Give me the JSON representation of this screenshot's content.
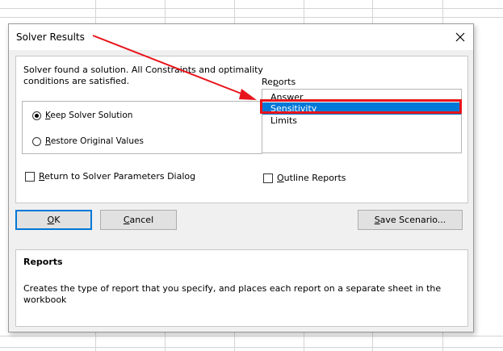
{
  "dialog": {
    "title": "Solver Results",
    "message": "Solver found a solution.  All Constraints and optimality conditions are satisfied.",
    "options": {
      "keep_label": "eep Solver Solution",
      "keep_mnemonic": "K",
      "keep_checked": true,
      "restore_label": "estore Original Values",
      "restore_mnemonic": "R",
      "restore_checked": false
    },
    "return_dialog": {
      "mnemonic": "R",
      "label": "eturn to Solver Parameters Dialog",
      "checked": false
    },
    "reports": {
      "label_pre": "Re",
      "label_mnemonic": "p",
      "label_post": "orts",
      "items": [
        "Answer",
        "Sensitivity",
        "Limits"
      ],
      "selected_index": 1
    },
    "outline_reports": {
      "mnemonic": "O",
      "label": "utline Reports",
      "checked": false
    },
    "buttons": {
      "ok_mnemonic": "O",
      "ok_rest": "K",
      "cancel_mnemonic": "C",
      "cancel_rest": "ancel",
      "save_mnemonic": "S",
      "save_rest": "ave Scenario..."
    },
    "description": {
      "title": "Reports",
      "text": "Creates the type of report that you specify, and places each report on a separate sheet in the workbook"
    }
  },
  "annotation": {
    "highlight_color": "#e8141b",
    "arrow_color": "#e8141b"
  },
  "icons": [
    "close-icon",
    "radio-icon",
    "checkbox-icon"
  ]
}
